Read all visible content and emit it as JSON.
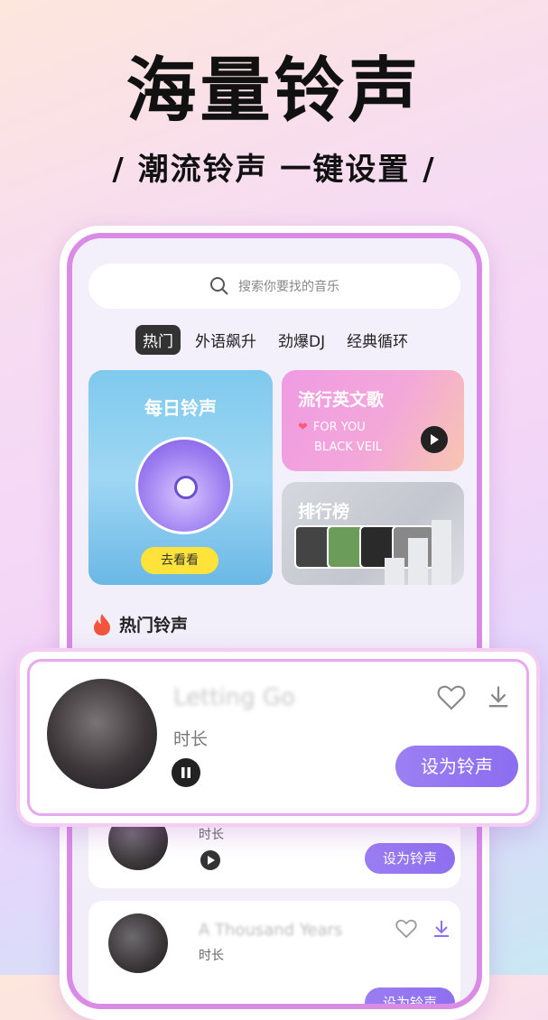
{
  "hero": {
    "title": "海量铃声",
    "subtitle": "/ 潮流铃声  一键设置 /"
  },
  "search": {
    "placeholder": "搜索你要找的音乐"
  },
  "tabs": [
    {
      "label": "热门",
      "active": true
    },
    {
      "label": "外语飙升"
    },
    {
      "label": "劲爆DJ"
    },
    {
      "label": "经典循环"
    }
  ],
  "cards": {
    "daily": {
      "title": "每日铃声",
      "button": "去看看"
    },
    "pop": {
      "title": "流行英文歌",
      "line1": "FOR YOU",
      "line2": "BLACK VEIL"
    },
    "rank": {
      "title": "排行榜"
    }
  },
  "section": {
    "title": "热门铃声"
  },
  "featured": {
    "name": "Letting Go",
    "duration_label": "时长",
    "set_button": "设为铃声"
  },
  "list": [
    {
      "name": "",
      "duration_label": "时长",
      "set_button": "设为铃声"
    },
    {
      "name": "A Thousand Years",
      "duration_label": "时长",
      "set_button": "设为铃声"
    }
  ],
  "colors": {
    "accent": "#8e6ff0",
    "frame": "#d98be6"
  }
}
